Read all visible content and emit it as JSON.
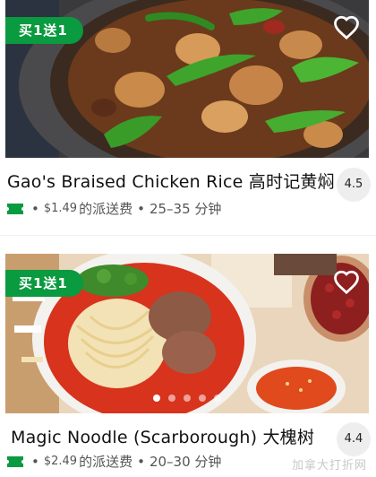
{
  "restaurants": [
    {
      "promo": "买1送1",
      "name": "Gao's Braised Chicken Rice 高时记黄焖",
      "rating": "4.5",
      "delivery_fee": "$1.49",
      "fee_label": "的派送费",
      "time": "25–35 分钟",
      "favorite_icon": "heart-outline-icon",
      "offer_icon": "ticket-icon"
    },
    {
      "promo": "买1送1",
      "name": "Magic Noodle (Scarborough) 大槐树",
      "rating": "4.4",
      "delivery_fee": "$2.49",
      "fee_label": "的派送费",
      "time": "20–30 分钟",
      "favorite_icon": "heart-outline-icon",
      "offer_icon": "ticket-icon",
      "carousel": {
        "count": 5,
        "active": 0
      }
    }
  ],
  "separator": "•",
  "watermark": "加拿大打折网",
  "colors": {
    "promo_green": "#0a9a3f",
    "rating_bg": "#eeeeee",
    "text_secondary": "#555555"
  }
}
